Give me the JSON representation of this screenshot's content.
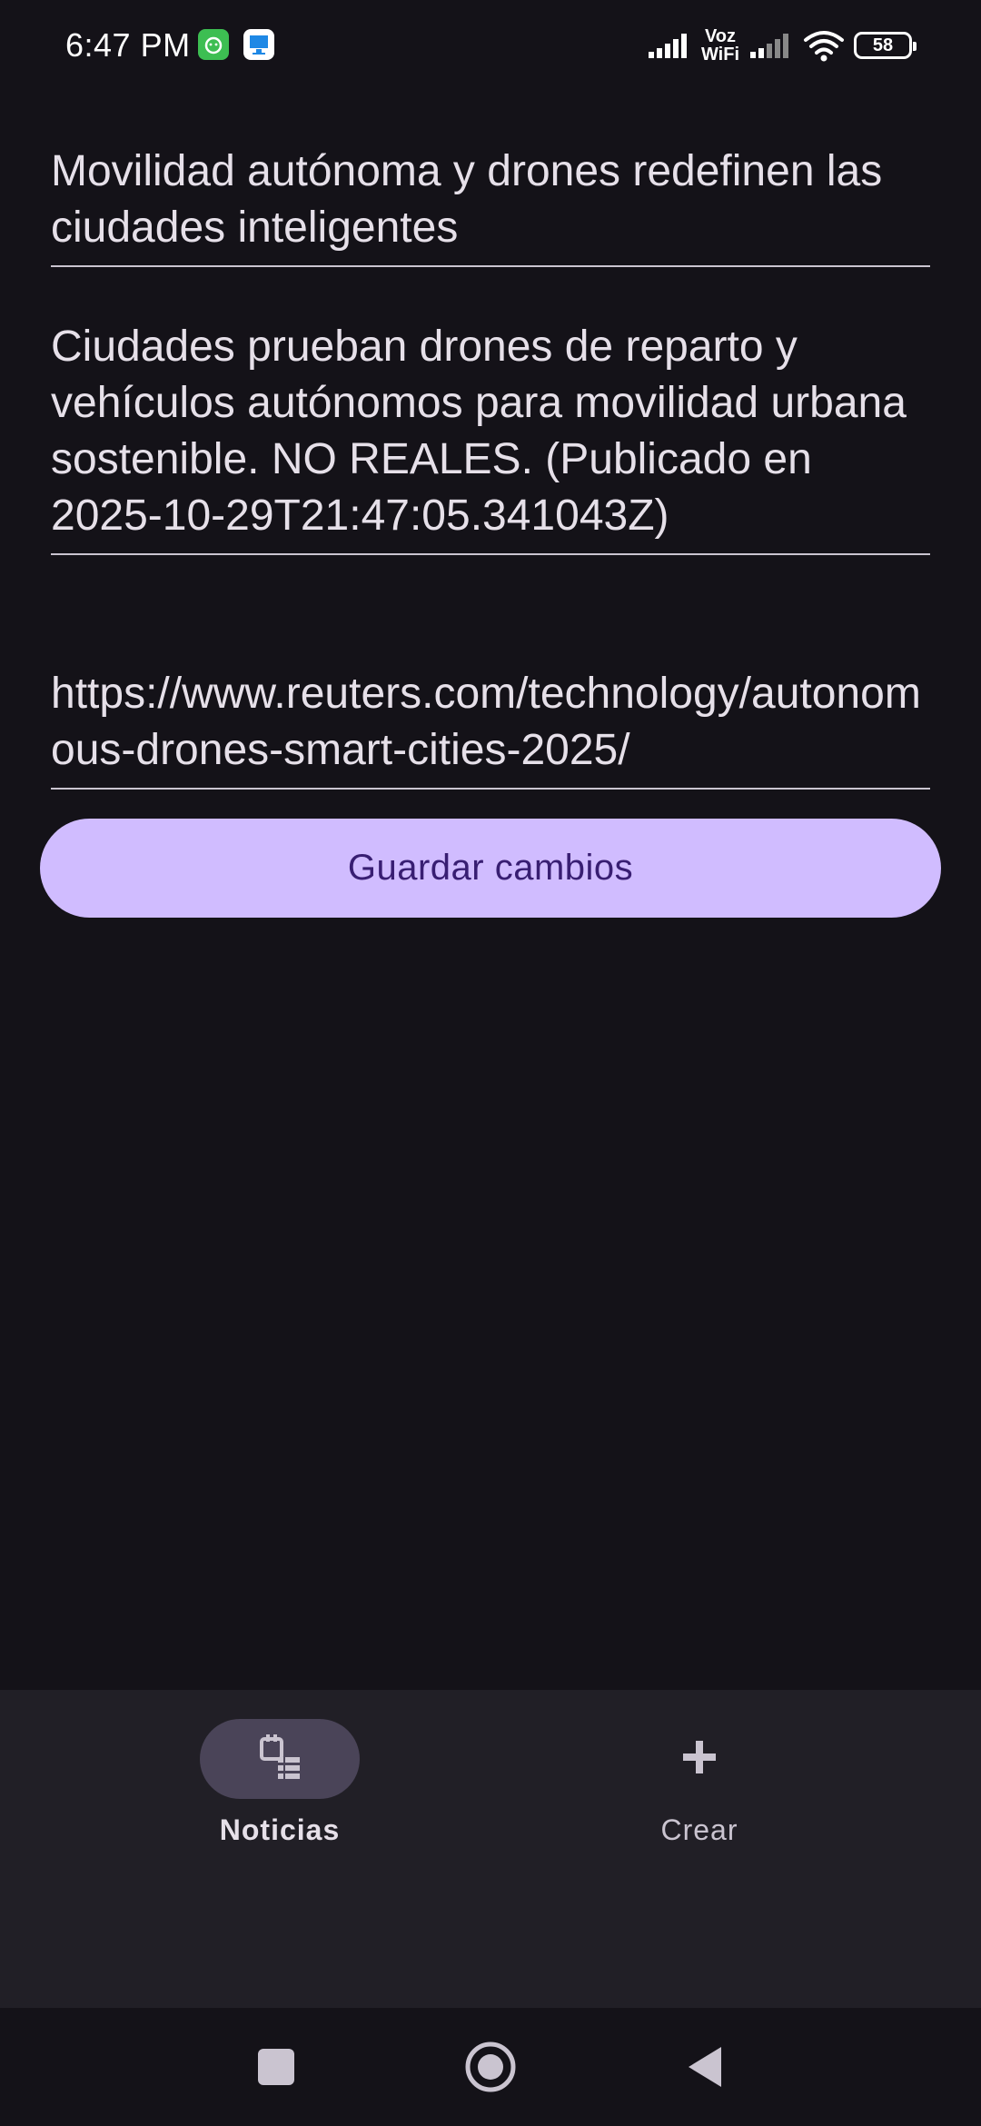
{
  "status_bar": {
    "time": "6:47 PM",
    "voz_line1": "Voz",
    "voz_line2": "WiFi",
    "battery": "58"
  },
  "form": {
    "title_value": "Movilidad autónoma y drones redefinen las ciudades inteligentes",
    "description_value": "Ciudades prueban drones de reparto y vehículos autónomos para movilidad urbana sostenible. NO REALES. (Publicado en 2025-10-29T21:47:05.341043Z)",
    "url_value": "https://www.reuters.com/technology/autonomous-drones-smart-cities-2025/",
    "save_label": "Guardar cambios"
  },
  "bottom_nav": {
    "items": [
      {
        "label": "Noticias",
        "icon": "news-list-icon",
        "selected": true
      },
      {
        "label": "Crear",
        "icon": "plus-icon",
        "selected": false
      }
    ]
  },
  "colors": {
    "background": "#141218",
    "nav_background": "#211F26",
    "button": "#D0BCFF",
    "button_text": "#381E72",
    "indicator": "#4A4458"
  }
}
